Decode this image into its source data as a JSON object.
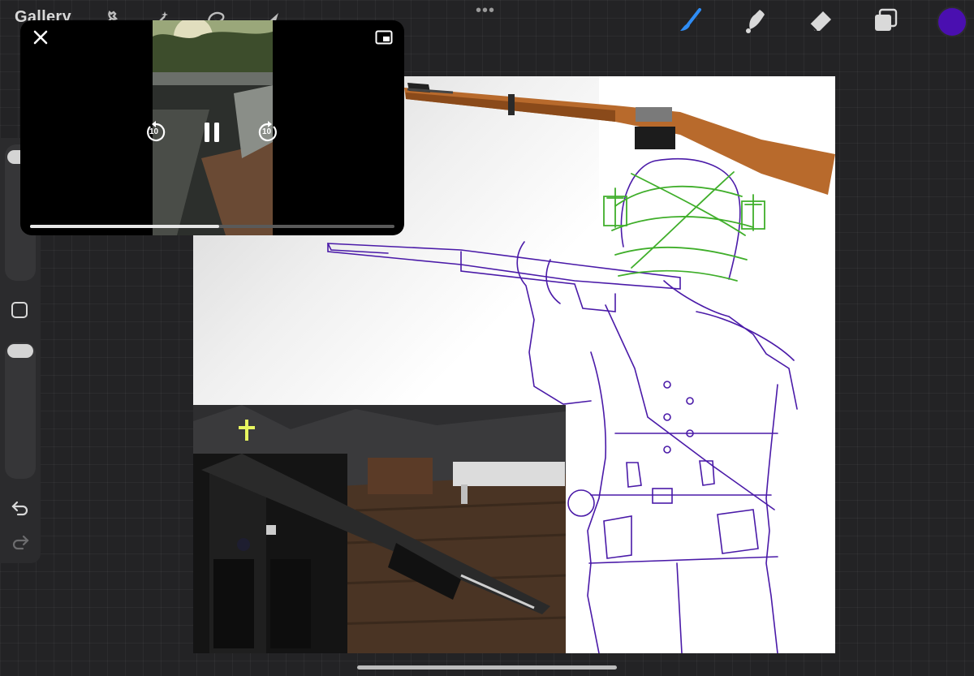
{
  "topbar": {
    "gallery_label": "Gallery",
    "left_tools": [
      "wrench-icon",
      "magic-wand-icon",
      "selection-icon",
      "transform-arrow-icon"
    ],
    "more_dots": "•••",
    "right_tools": [
      "brush-icon",
      "smudge-icon",
      "eraser-icon",
      "layers-icon"
    ],
    "active_tool": "brush-icon",
    "current_color": "#4a0fb0"
  },
  "sidebar": {
    "size_slider_level": 0.05,
    "opacity_slider_level": 0.05,
    "modify_button": "square-modify-icon",
    "undo": "undo-icon",
    "redo": "redo-icon"
  },
  "video_pip": {
    "close": "close-icon",
    "expand": "picture-in-picture-icon",
    "skip_back_label": "10",
    "skip_forward_label": "10",
    "state": "playing",
    "progress": 0.52
  },
  "canvas": {
    "layers": [
      "rifle-reference-photo",
      "game-render-reference",
      "character-sketch-purple",
      "thorn-crown-sketch-green"
    ],
    "sketch_color": "#4a1aa8",
    "accent_sketch_color": "#3fae2a"
  }
}
